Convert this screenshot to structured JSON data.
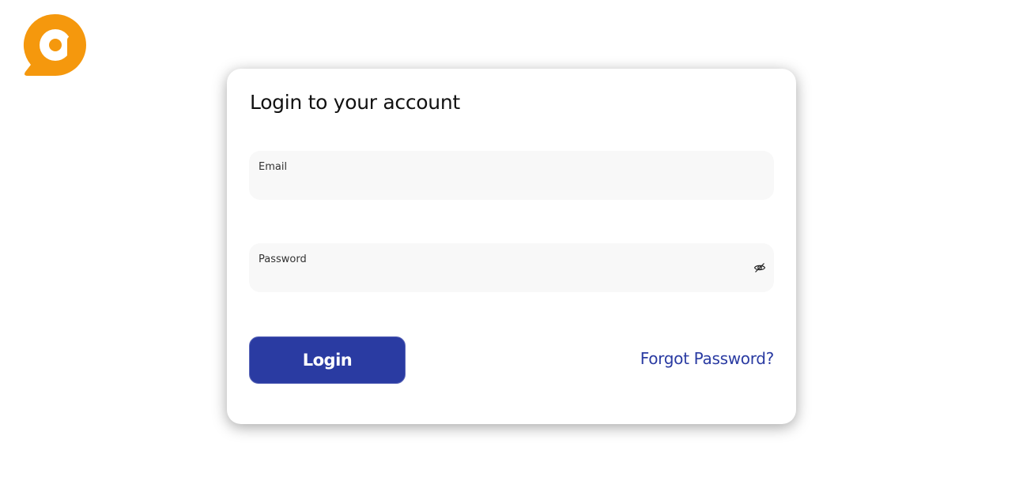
{
  "brand": {
    "logo_icon": "chat-bubble-a-logo-icon",
    "logo_color": "#f5980d"
  },
  "login_card": {
    "title": "Login to your account",
    "email": {
      "label": "Email",
      "value": ""
    },
    "password": {
      "label": "Password",
      "value": "",
      "toggle_icon": "eye-slash-icon"
    },
    "login_button_label": "Login",
    "forgot_password_label": "Forgot Password?"
  },
  "colors": {
    "accent": "#2a3ba2",
    "field_background": "#f8f8f8",
    "page_background": "#ffffff"
  }
}
